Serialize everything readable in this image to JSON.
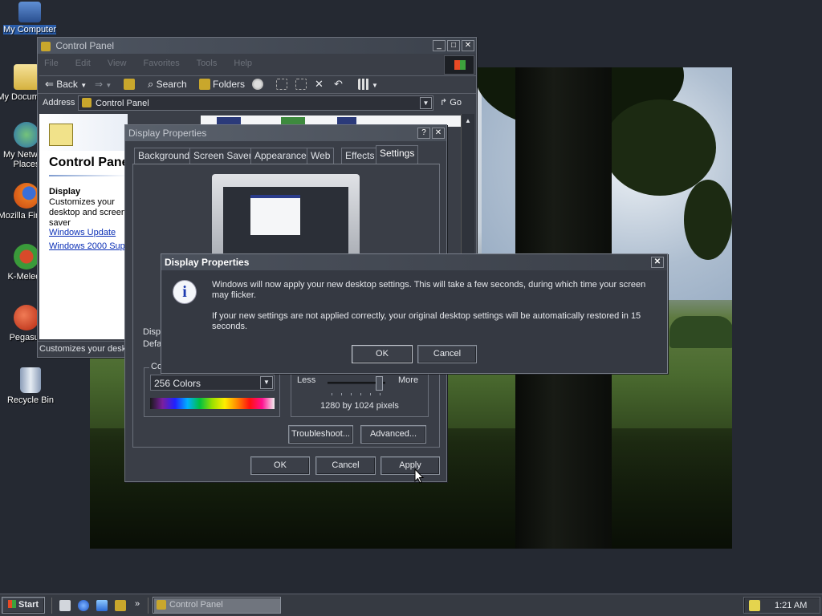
{
  "desktop": {
    "icons": [
      {
        "label": "My Computer",
        "icon": "computer-icon"
      },
      {
        "label": "My Documents",
        "icon": "documents-folder-icon"
      },
      {
        "label": "My Network Places",
        "icon": "network-icon"
      },
      {
        "label": "Mozilla Firefox",
        "icon": "firefox-icon"
      },
      {
        "label": "K-Meleon",
        "icon": "kmeleon-icon"
      },
      {
        "label": "Pegasus",
        "icon": "pegasus-icon"
      },
      {
        "label": "Recycle Bin",
        "icon": "recycle-bin-icon"
      }
    ]
  },
  "control_panel": {
    "title": "Control Panel",
    "menu": [
      "File",
      "Edit",
      "View",
      "Favorites",
      "Tools",
      "Help"
    ],
    "toolbar": {
      "back": "Back",
      "search": "Search",
      "folders": "Folders"
    },
    "address_label": "Address",
    "address_value": "Control Panel",
    "go": "Go",
    "panel_heading": "Control Panel",
    "selected_title": "Display",
    "selected_desc": "Customizes your desktop and screen saver",
    "links": [
      "Windows Update",
      "Windows 2000 Support"
    ],
    "status": "Customizes your desktop and screen saver"
  },
  "display_properties": {
    "title": "Display Properties",
    "help": "?",
    "tabs": [
      "Background",
      "Screen Saver",
      "Appearance",
      "Web",
      "Effects",
      "Settings"
    ],
    "display_label": "Display:",
    "display_value": "Default Monitor",
    "colors_label": "Colors",
    "colors_value": "256 Colors",
    "area_less": "Less",
    "area_more": "More",
    "resolution": "1280 by 1024 pixels",
    "troubleshoot": "Troubleshoot...",
    "advanced": "Advanced...",
    "ok": "OK",
    "cancel": "Cancel",
    "apply": "Apply"
  },
  "confirm_dialog": {
    "title": "Display Properties",
    "message1": "Windows will now apply your new desktop settings. This will take a few seconds, during which time your screen may flicker.",
    "message2": "If your new settings are not applied correctly, your original desktop settings will be automatically restored in 15 seconds.",
    "ok": "OK",
    "cancel": "Cancel"
  },
  "taskbar": {
    "start": "Start",
    "task": "Control Panel",
    "clock": "1:21 AM"
  },
  "colors": {
    "desktop": "#252932",
    "window": "#3a3e47",
    "link": "#0a2fb6"
  }
}
